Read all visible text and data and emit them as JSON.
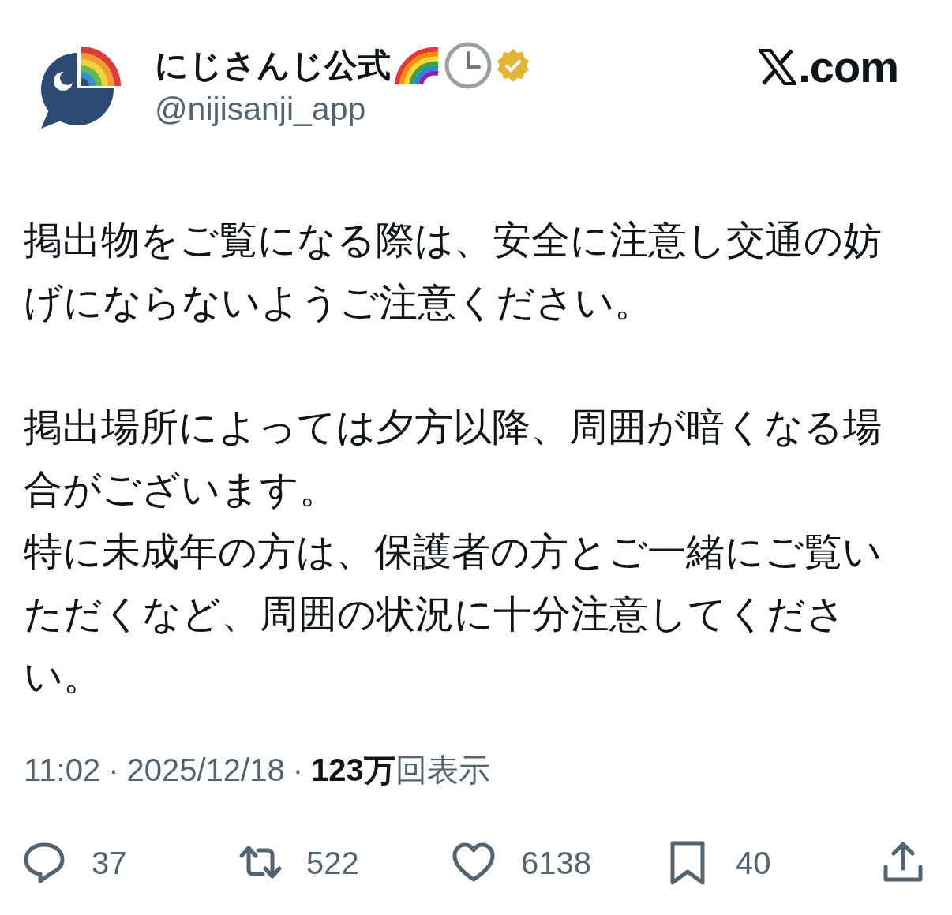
{
  "author": {
    "name": "にじさんじ公式",
    "handle": "@nijisanji_app",
    "verified": true
  },
  "brand": {
    "text": ".com"
  },
  "paragraphs": [
    [
      "掲出物をご覧になる際は、安全に注意し交通の妨げにならないようご注意ください。"
    ],
    [
      "掲出場所によっては夕方以降、周囲が暗くなる場合がございます。",
      "特に未成年の方は、保護者の方とご一緒にご覧いただくなど、周囲の状況に十分注意してください。"
    ]
  ],
  "meta": [
    {
      "kind": "plain",
      "text": "11:02"
    },
    {
      "kind": "dot",
      "text": "·"
    },
    {
      "kind": "plain",
      "text": "2025/12/18"
    },
    {
      "kind": "dot",
      "text": "·"
    },
    {
      "kind": "views",
      "text": "**123万**回表示"
    }
  ],
  "actions": [
    {
      "kind": "reply",
      "count": "37"
    },
    {
      "kind": "repost",
      "count": "522"
    },
    {
      "kind": "like",
      "count": "6138"
    },
    {
      "kind": "bookmark",
      "count": "40"
    },
    {
      "kind": "share"
    }
  ]
}
